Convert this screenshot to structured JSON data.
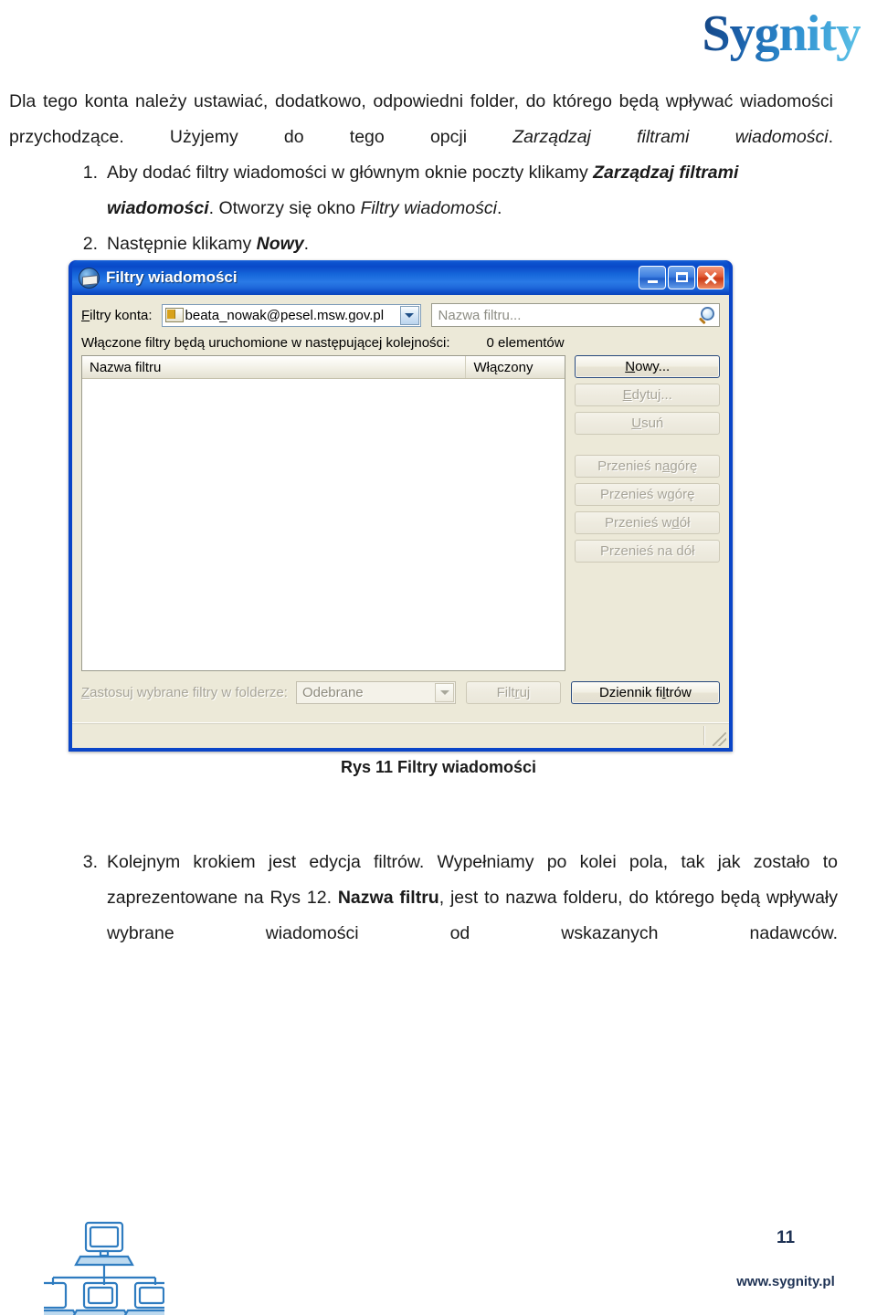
{
  "brand": {
    "logo_text": "Sygnity"
  },
  "document": {
    "intro": {
      "lead": "Dla tego konta należy ustawiać, dodatkowo, odpowiedni folder, do którego będą wpływać wiadomości przychodzące. Użyjemy do tego opcji ",
      "emphasis": "Zarządzaj filtrami wiadomości",
      "tail": "."
    },
    "steps_before": [
      {
        "number": "1.",
        "text_a": "Aby dodać filtry wiadomości w głównym oknie poczty klikamy ",
        "strong": "Zarządzaj filtrami wiadomości",
        "text_b": ". Otworzy się okno ",
        "emphasis": "Filtry wiadomości",
        "text_c": "."
      },
      {
        "number": "2.",
        "text_a": "Następnie klikamy ",
        "strong": "Nowy",
        "text_b": ".",
        "emphasis": "",
        "text_c": ""
      }
    ],
    "figure_caption": "Rys 11 Filtry wiadomości",
    "steps_after": [
      {
        "number": "3.",
        "text_a": "Kolejnym krokiem jest edycja filtrów. Wypełniamy po kolei pola, tak jak zostało to zaprezentowane na Rys 12.  ",
        "strong": "Nazwa filtru",
        "text_b": ", jest to nazwa folderu, do którego będą wpływały wybrane wiadomości od wskazanych nadawców.",
        "emphasis": "",
        "text_c": ""
      }
    ]
  },
  "dialog": {
    "title": "Filtry wiadomości",
    "icon": "mail-filter-icon",
    "caption_buttons": {
      "minimize": "minimize-icon",
      "maximize": "maximize-icon",
      "close": "close-icon"
    },
    "account_label": "Filtry konta:",
    "account_value": "beata_nowak@pesel.msw.gov.pl",
    "search_placeholder": "Nazwa filtru...",
    "order_hint": "Włączone filtry będą uruchomione w następującej kolejności:",
    "element_count": "0 elementów",
    "columns": {
      "name": "Nazwa filtru",
      "enabled": "Włączony"
    },
    "rows": [],
    "side_buttons": [
      {
        "label": "Nowy...",
        "state": "default"
      },
      {
        "label": "Edytuj...",
        "state": "disabled"
      },
      {
        "label": "Usuń",
        "state": "disabled"
      },
      {
        "label": "Przenieś na górę",
        "state": "disabled"
      },
      {
        "label": "Przenieś w górę",
        "state": "disabled"
      },
      {
        "label": "Przenieś w dół",
        "state": "disabled"
      },
      {
        "label": "Przenieś na dół",
        "state": "disabled"
      }
    ],
    "apply_label": "Zastosuj wybrane filtry w folderze:",
    "folder_value": "Odebrane",
    "filter_button": "Filtruj",
    "log_button": "Dziennik filtrów"
  },
  "footer": {
    "page_number": "11",
    "url": "www.sygnity.pl",
    "icon": "computer-network-icon"
  },
  "colors": {
    "titlebar_blue": "#0a45c8",
    "dialog_face": "#ece9d8",
    "brand_blue": "#1f3355",
    "accent_cyan": "#5ec4e8"
  }
}
